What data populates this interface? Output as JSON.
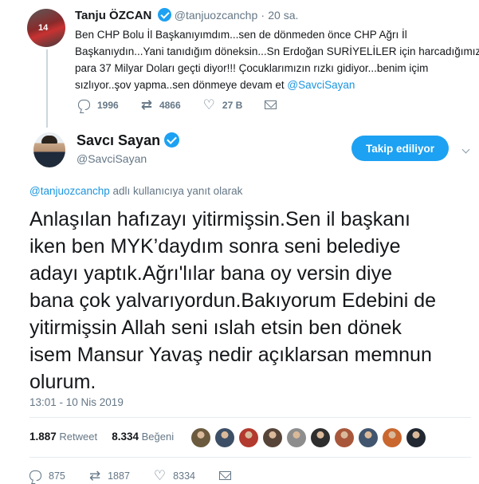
{
  "parent_tweet": {
    "name": "Tanju ÖZCAN",
    "handle": "@tanjuozcanchp",
    "separator": "·",
    "time": "20 sa.",
    "avatar_number": "14",
    "text_lines": [
      "Ben CHP Bolu İl Başkanıyımdım...sen de dönmeden önce CHP Ağrı İl",
      "Başkanıydın...Yani tanıdığım döneksin...Sn Erdoğan SURİYELİLER için harcadığımız",
      "para 37 Milyar Doları geçti diyor!!! Çocuklarımızın rızkı gidiyor...benim içim"
    ],
    "text_last_line_prefix": "sızlıyor..şov yapma..sen dönmeye devam et ",
    "text_mention": "@SavciSayan",
    "actions": {
      "replies": "1996",
      "retweets": "4866",
      "likes": "27 B"
    }
  },
  "main_tweet": {
    "name": "Savcı Sayan",
    "handle": "@SavciSayan",
    "follow_button": "Takip ediliyor",
    "reply_to_mention": "@tanjuozcanchp",
    "reply_to_suffix": " adlı kullanıcıya yanıt olarak",
    "text_lines": [
      "Anlaşılan hafızayı yitirmişsin.Sen il başkanı",
      "iken ben MYK’daydım sonra seni belediye",
      "adayı yaptık.Ağrı'lılar bana oy versin diye",
      "bana çok yalvarıyordun.Bakıyorum Edebini de",
      "yitirmişsin Allah seni ıslah etsin ben dönek",
      "isem Mansur Yavaş nedir açıklarsan memnun",
      "olurum."
    ],
    "timestamp": "13:01 - 10 Nis 2019",
    "retweet_count": "1.887",
    "retweet_label": "Retweet",
    "like_count": "8.334",
    "like_label": "Beğeni",
    "liker_colors": [
      "#6b5a3e",
      "#3c4f66",
      "#b23a2e",
      "#574438",
      "#8d8d8d",
      "#2e2e2e",
      "#a8573b",
      "#41556e",
      "#c9672f",
      "#222831"
    ],
    "actions": {
      "replies": "875",
      "retweets": "1887",
      "likes": "8334"
    }
  },
  "icons": {
    "reply": "reply-icon",
    "retweet": "retweet-icon",
    "like": "heart-icon",
    "message": "envelope-icon",
    "verified": "verified-badge-icon",
    "more": "chevron-down-icon"
  },
  "colors": {
    "accent": "#1da1f2",
    "link": "#1b95e0",
    "muted": "#657786"
  }
}
